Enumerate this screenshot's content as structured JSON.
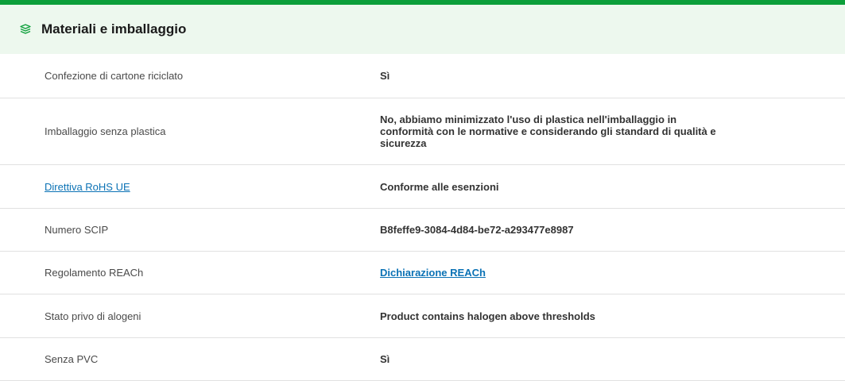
{
  "section": {
    "title": "Materiali e imballaggio",
    "icon": "layers-icon",
    "accent_color": "#0c9f3a",
    "header_bg": "#edf8ee"
  },
  "rows": [
    {
      "label": "Confezione di cartone riciclato",
      "value": "Sì"
    },
    {
      "label": "Imballaggio senza plastica",
      "value": "No, abbiamo minimizzato l'uso di plastica nell'imballaggio in conformità con le normative e considerando gli standard di qualità e sicurezza"
    },
    {
      "label": "Direttiva RoHS UE",
      "value": "Conforme alle esenzioni"
    },
    {
      "label": "Numero SCIP",
      "value": "B8feffe9-3084-4d84-be72-a293477e8987"
    },
    {
      "label": "Regolamento REACh",
      "value": "Dichiarazione REACh"
    },
    {
      "label": "Stato privo di alogeni",
      "value": "Product contains halogen above thresholds"
    },
    {
      "label": "Senza PVC",
      "value": "Sì"
    }
  ]
}
